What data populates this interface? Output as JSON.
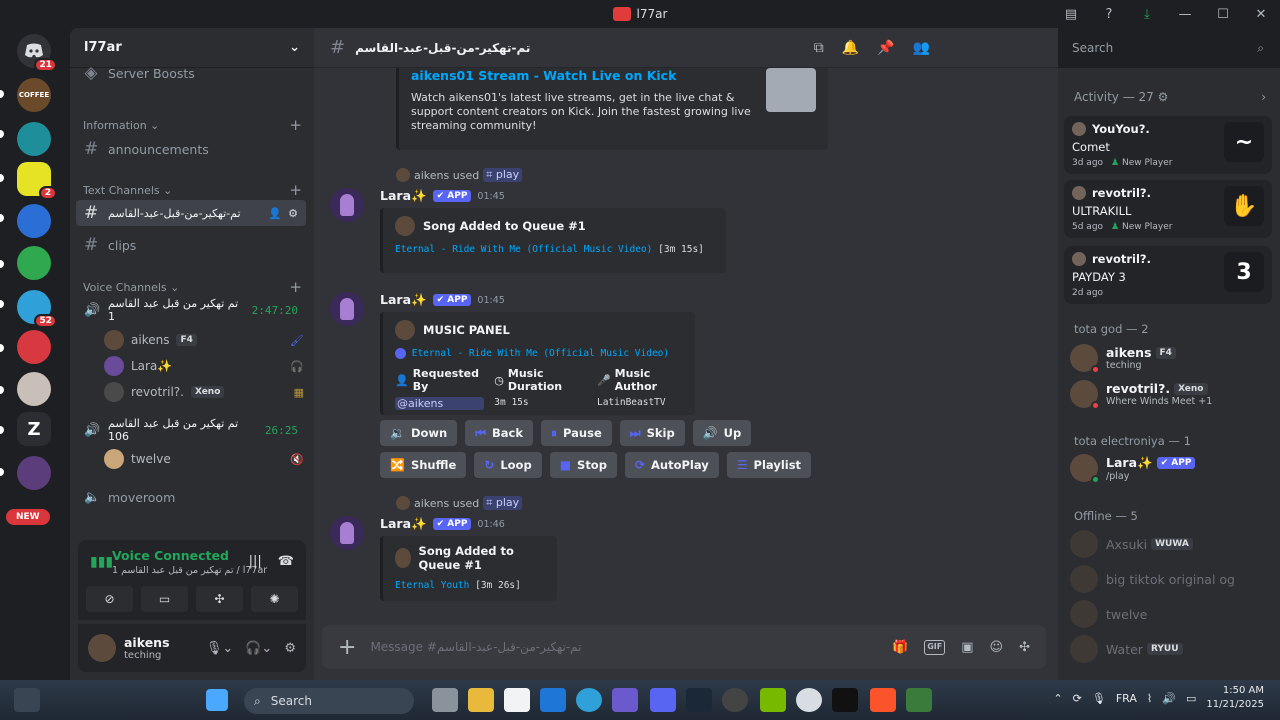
{
  "window": {
    "title": "l77ar",
    "buttons": [
      "inbox-icon",
      "help-icon",
      "download-icon",
      "minimize",
      "maximize",
      "close"
    ],
    "glyphs": {
      "inbox": "▤",
      "help": "?",
      "download": "⤓",
      "minimize": "—",
      "maximize": "☐",
      "close": "✕"
    }
  },
  "rail": {
    "home_badge": "21",
    "servers": [
      {
        "name": "coffee-server",
        "color": "#6b4a2b",
        "label": "COFFEE"
      },
      {
        "name": "house-server",
        "color": "#1f8e9b",
        "label": ""
      },
      {
        "name": "twitch-server",
        "color": "#e6e224",
        "label": "",
        "badge": "2"
      },
      {
        "name": "blue-server",
        "color": "#2b6fd6",
        "label": ""
      },
      {
        "name": "green-server",
        "color": "#2fa84f",
        "label": ""
      },
      {
        "name": "cat-server",
        "color": "#2fa0d8",
        "label": "",
        "badge": "52"
      },
      {
        "name": "red-server",
        "color": "#d8383f",
        "label": ""
      },
      {
        "name": "anime-server",
        "color": "#c8bfb8",
        "label": ""
      },
      {
        "name": "logo-server",
        "color": "#2b2d31",
        "label": "Z"
      },
      {
        "name": "art-server",
        "color": "#5a3d7a",
        "label": ""
      }
    ],
    "new_label": "NEW"
  },
  "sidebar": {
    "guild_name": "l77ar",
    "server_boosts": "Server Boosts",
    "cat_information": "Information",
    "ch_announcements": "announcements",
    "cat_text": "Text Channels",
    "ch_active": "تم-تهكير-من-قبل-عبد-القاسم",
    "ch_clips": "clips",
    "cat_voice": "Voice Channels",
    "voice1": {
      "name": "تم تهكير من قبل عبد القاسم 1",
      "time": "2:47:20"
    },
    "voice1_users": [
      {
        "name": "aikens",
        "tag": "F4"
      },
      {
        "name": "Lara✨",
        "tag": ""
      },
      {
        "name": "revotril?.",
        "tag": "Xeno"
      }
    ],
    "voice2": {
      "name": "تم تهكير من قبل عبد القاسم 106",
      "time": "26:25"
    },
    "voice2_users": [
      {
        "name": "twelve"
      }
    ],
    "voice3": {
      "name": "moveroom"
    }
  },
  "voice_panel": {
    "title": "Voice Connected",
    "sub": "تم تهكير من قبل عبد القاسم 1 / l77ar"
  },
  "user_panel": {
    "name": "aikens",
    "status": "teching"
  },
  "header": {
    "channel": "تم-تهكير-من-قبل-عبد-القاسم",
    "search_placeholder": "Search"
  },
  "chat": {
    "kick_embed": {
      "title": "aikens01 Stream - Watch Live on Kick",
      "desc": "Watch aikens01's latest live streams, get in the live chat & support content creators on Kick. Join the fastest growing live streaming community!"
    },
    "msg1": {
      "reply_user": "aikens used",
      "reply_cmd": "⌗ play",
      "author": "Lara✨",
      "badge": "✔ APP",
      "time": "01:45",
      "embed_title": "Song Added to Queue #1",
      "song": "Eternal - Ride With Me (Official Music Video)",
      "dur": "[3m 15s]"
    },
    "msg2": {
      "author": "Lara✨",
      "badge": "✔ APP",
      "time": "01:45",
      "embed_title": "MUSIC PANEL",
      "song": "Eternal - Ride With Me (Official Music Video)",
      "f1_label": "Requested By",
      "f1_value": "@aikens",
      "f2_label": "Music Duration",
      "f2_value": "3m 15s",
      "f3_label": "Music Author",
      "f3_value": "LatinBeastTV",
      "row1": [
        {
          "label": "Down",
          "icon": "🔉"
        },
        {
          "label": "Back",
          "icon": "⏮"
        },
        {
          "label": "Pause",
          "icon": "⏸"
        },
        {
          "label": "Skip",
          "icon": "⏭"
        },
        {
          "label": "Up",
          "icon": "🔊"
        }
      ],
      "row2": [
        {
          "label": "Shuffle",
          "icon": "🔀"
        },
        {
          "label": "Loop",
          "icon": "↻"
        },
        {
          "label": "Stop",
          "icon": "■"
        },
        {
          "label": "AutoPlay",
          "icon": "⟳"
        },
        {
          "label": "Playlist",
          "icon": "☰"
        }
      ]
    },
    "msg3": {
      "reply_user": "aikens used",
      "reply_cmd": "⌗ play",
      "author": "Lara✨",
      "badge": "✔ APP",
      "time": "01:46",
      "embed_title": "Song Added to Queue #1",
      "song": "Eternal Youth",
      "dur": "[3m 26s]"
    },
    "composer_placeholder": "Message #تم-تهكير-من-قبل-عبد-القاسم"
  },
  "members": {
    "activity_header": "Activity — 27",
    "activities": [
      {
        "name": "YouYou?.",
        "title": "Comet",
        "ago": "3d ago",
        "tag": "New Player",
        "thumb": "~"
      },
      {
        "name": "revotril?.",
        "title": "ULTRAKILL",
        "ago": "5d ago",
        "tag": "New Player",
        "thumb": "✋"
      },
      {
        "name": "revotril?.",
        "title": "PAYDAY 3",
        "ago": "2d ago",
        "tag": "",
        "thumb": "3"
      }
    ],
    "group1": "tota god — 2",
    "g1": [
      {
        "name": "aikens",
        "tag": "F4",
        "sub": "teching",
        "status": "#f23f43"
      },
      {
        "name": "revotril?.",
        "tag": "Xeno",
        "sub": "Where Winds Meet +1",
        "status": "#f23f43"
      }
    ],
    "group2": "tota electroniya — 1",
    "g2": [
      {
        "name": "Lara✨",
        "tag": "✔ APP",
        "sub": "/play",
        "status": "#23a55a"
      }
    ],
    "group3": "Offline — 5",
    "offline": [
      {
        "name": "Axsuki",
        "tag": "WUWA"
      },
      {
        "name": "big tiktok original og",
        "tag": ""
      },
      {
        "name": "twelve",
        "tag": ""
      },
      {
        "name": "Water",
        "tag": "RYUU"
      }
    ]
  },
  "taskbar": {
    "search": "Search",
    "lang": "FRA",
    "time": "1:50 AM",
    "date": "11/21/2025"
  }
}
